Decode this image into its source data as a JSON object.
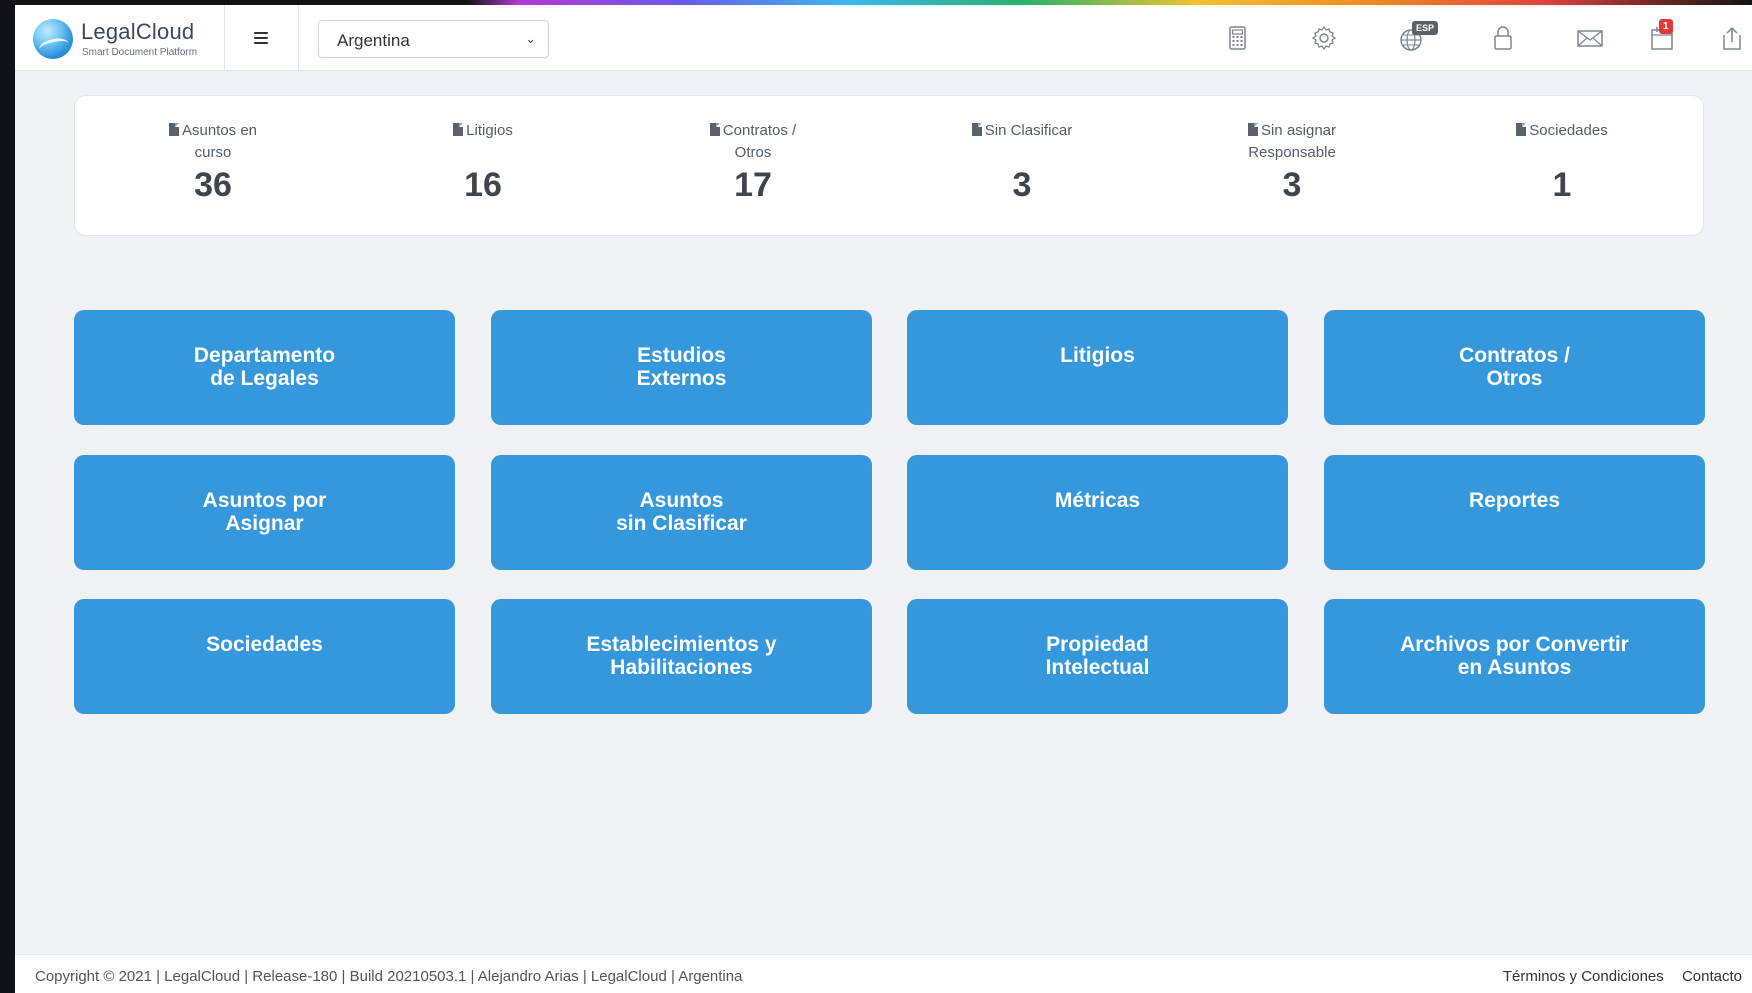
{
  "brand": {
    "name": "LegalCloud",
    "tagline": "Smart Document Platform"
  },
  "header": {
    "country_select": {
      "value": "Argentina"
    },
    "icons": [
      {
        "name": "calculator-icon"
      },
      {
        "name": "settings-gear-icon"
      },
      {
        "name": "language-globe-icon",
        "badge": "ESP"
      },
      {
        "name": "lock-icon"
      },
      {
        "name": "mail-icon"
      },
      {
        "name": "calendar-icon",
        "badge": "1"
      },
      {
        "name": "logout-icon"
      }
    ]
  },
  "stats": [
    {
      "label": "Asuntos en\ncurso",
      "value": "36"
    },
    {
      "label": "Litigios",
      "value": "16"
    },
    {
      "label": "Contratos /\nOtros",
      "value": "17"
    },
    {
      "label": "Sin Clasificar",
      "value": "3"
    },
    {
      "label": "Sin asignar\nResponsable",
      "value": "3"
    },
    {
      "label": "Sociedades",
      "value": "1"
    }
  ],
  "tiles": [
    {
      "label": "Departamento\nde Legales"
    },
    {
      "label": "Estudios\nExternos"
    },
    {
      "label": "Litigios"
    },
    {
      "label": "Contratos /\nOtros"
    },
    {
      "label": "Asuntos por\nAsignar"
    },
    {
      "label": "Asuntos\nsin Clasificar"
    },
    {
      "label": "Métricas"
    },
    {
      "label": "Reportes"
    },
    {
      "label": "Sociedades"
    },
    {
      "label": "Establecimientos y\nHabilitaciones"
    },
    {
      "label": "Propiedad\nIntelectual"
    },
    {
      "label": "Archivos por Convertir\nen Asuntos"
    }
  ],
  "footer": {
    "copyright": "Copyright © 2021 | LegalCloud | Release-180 | Build 20210503.1 | Alejandro Arias | LegalCloud | Argentina",
    "terms": "Términos y Condiciones",
    "contact": "Contacto"
  },
  "colors": {
    "tile_blue": "#3598dc",
    "badge_red": "#e53935"
  }
}
